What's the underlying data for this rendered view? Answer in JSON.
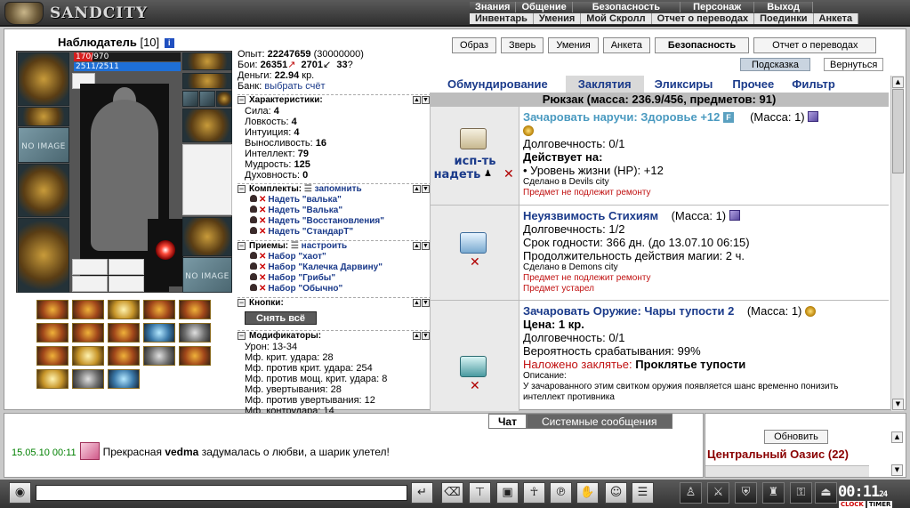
{
  "app": {
    "title": "SANDCITY"
  },
  "topmenu": {
    "row1": [
      "Знания",
      "Общение",
      "Безопасность",
      "Персонаж",
      "Выход"
    ],
    "row2": [
      "Инвентарь",
      "Умения",
      "Мой Скролл",
      "Отчет о переводах",
      "Поединки",
      "Анкета"
    ]
  },
  "character": {
    "name": "Наблюдатель",
    "level": "[10]",
    "info_icon": "i",
    "hp": "170/970",
    "hp_fraction": 0.175,
    "mp": "2511/2511",
    "mp_fraction": 1.0,
    "empty_slot_label": "NO IMAGE"
  },
  "stats": {
    "exp_label": "Опыт:",
    "exp_value": "22247659",
    "exp_next": "(30000000)",
    "fights_label": "Бои:",
    "wins": "26351",
    "losses": "2701",
    "draws": "33",
    "money_label": "Деньги:",
    "money_value": "22.94",
    "money_unit": "кр.",
    "bank_label": "Банк:",
    "bank_link": "выбрать счёт"
  },
  "characteristics": {
    "title": "Характеристики:",
    "items": [
      {
        "label": "Сила:",
        "value": "4"
      },
      {
        "label": "Ловкость:",
        "value": "4"
      },
      {
        "label": "Интуиция:",
        "value": "4"
      },
      {
        "label": "Выносливость:",
        "value": "16"
      },
      {
        "label": "Интеллект:",
        "value": "79"
      },
      {
        "label": "Мудрость:",
        "value": "125"
      },
      {
        "label": "Духовность:",
        "value": "0"
      }
    ]
  },
  "sets": {
    "title": "Комплекты:",
    "link": "запомнить",
    "items": [
      "Надеть \"валька\"",
      "Надеть \"Валька\"",
      "Надеть \"Восстановления\"",
      "Надеть \"СтандарТ\""
    ]
  },
  "tricks": {
    "title": "Приемы:",
    "link": "настроить",
    "items": [
      "Набор \"хаот\"",
      "Набор \"Калечка Дарвину\"",
      "Набор \"Грибы\"",
      "Набор \"Обычно\""
    ]
  },
  "buttons": {
    "title": "Кнопки:",
    "remove_all": "Снять всё"
  },
  "modifiers": {
    "title": "Модификаторы:",
    "items": [
      {
        "label": "Урон:",
        "value": "13-34"
      },
      {
        "label": "Мф. крит. удара:",
        "value": "28"
      },
      {
        "label": "Мф. против крит. удара:",
        "value": "254"
      },
      {
        "label": "Мф. против мощ. крит. удара:",
        "value": "8"
      },
      {
        "label": "Мф. увертывания:",
        "value": "28"
      },
      {
        "label": "Мф. против увертывания:",
        "value": "12"
      },
      {
        "label": "Мф. контрудара:",
        "value": "14"
      }
    ]
  },
  "top_buttons": [
    "Образ",
    "Зверь",
    "Умения",
    "Анкета",
    "Безопасность",
    "Отчет о переводах"
  ],
  "hint_button": "Подсказка",
  "back_button": "Вернуться",
  "tabs": [
    "Обмундирование",
    "Заклятия",
    "Эликсиры",
    "Прочее",
    "Фильтр"
  ],
  "backpack": {
    "title": "Рюкзак (масса: 236.9/456, предметов: 91)"
  },
  "items": [
    {
      "name": "Зачаровать наручи: Здоровье +12",
      "mass": "(Масса: 1)",
      "use_label": "исп-ть",
      "equip_label": "надеть",
      "durability": "Долговечность: 0/1",
      "effect_header": "Действует на:",
      "effect": "• Уровень жизни (HP): +12",
      "made_in": "Сделано в Devils city",
      "note": "Предмет не подлежит ремонту"
    },
    {
      "name": "Неуязвимость Стихиям",
      "mass": "(Масса: 1)",
      "durability": "Долговечность: 1/2",
      "expiry": "Срок годности: 366 дн. (до 13.07.10 06:15)",
      "duration": "Продолжительность действия магии: 2 ч.",
      "made_in": "Сделано в Demons city",
      "note": "Предмет не подлежит ремонту",
      "note2": "Предмет устарел"
    },
    {
      "name": "Зачаровать Оружие: Чары тупости 2",
      "mass": "(Масса: 1)",
      "price": "Цена: 1 кр.",
      "durability": "Долговечность: 0/1",
      "chance": "Вероятность срабатывания: 99%",
      "spell_label": "Наложено заклятье:",
      "spell_name": "Проклятье тупости",
      "desc_label": "Описание:",
      "desc": "У зачарованного этим свитком оружия появляется шанс временно понизить интеллект противника"
    }
  ],
  "chat": {
    "tabs": [
      "Чат",
      "Системные сообщения"
    ],
    "message": {
      "time": "15.05.10 00:11",
      "prefix": "Прекрасная",
      "user": "vedma",
      "text": "задумалась о любви, а шарик улетел!"
    },
    "input_value": ""
  },
  "location": {
    "refresh": "Обновить",
    "name": "Центральный Оазис (22)"
  },
  "clock": {
    "time": "00:11",
    "seconds": "24",
    "label_clock": "CLOCK",
    "label_timer": "TIMER"
  },
  "colors": {
    "accent": "#1a3a8a",
    "hp": "#d61e1e",
    "mp": "#1e6fd6",
    "danger": "#c01010",
    "location": "#8a0000"
  }
}
